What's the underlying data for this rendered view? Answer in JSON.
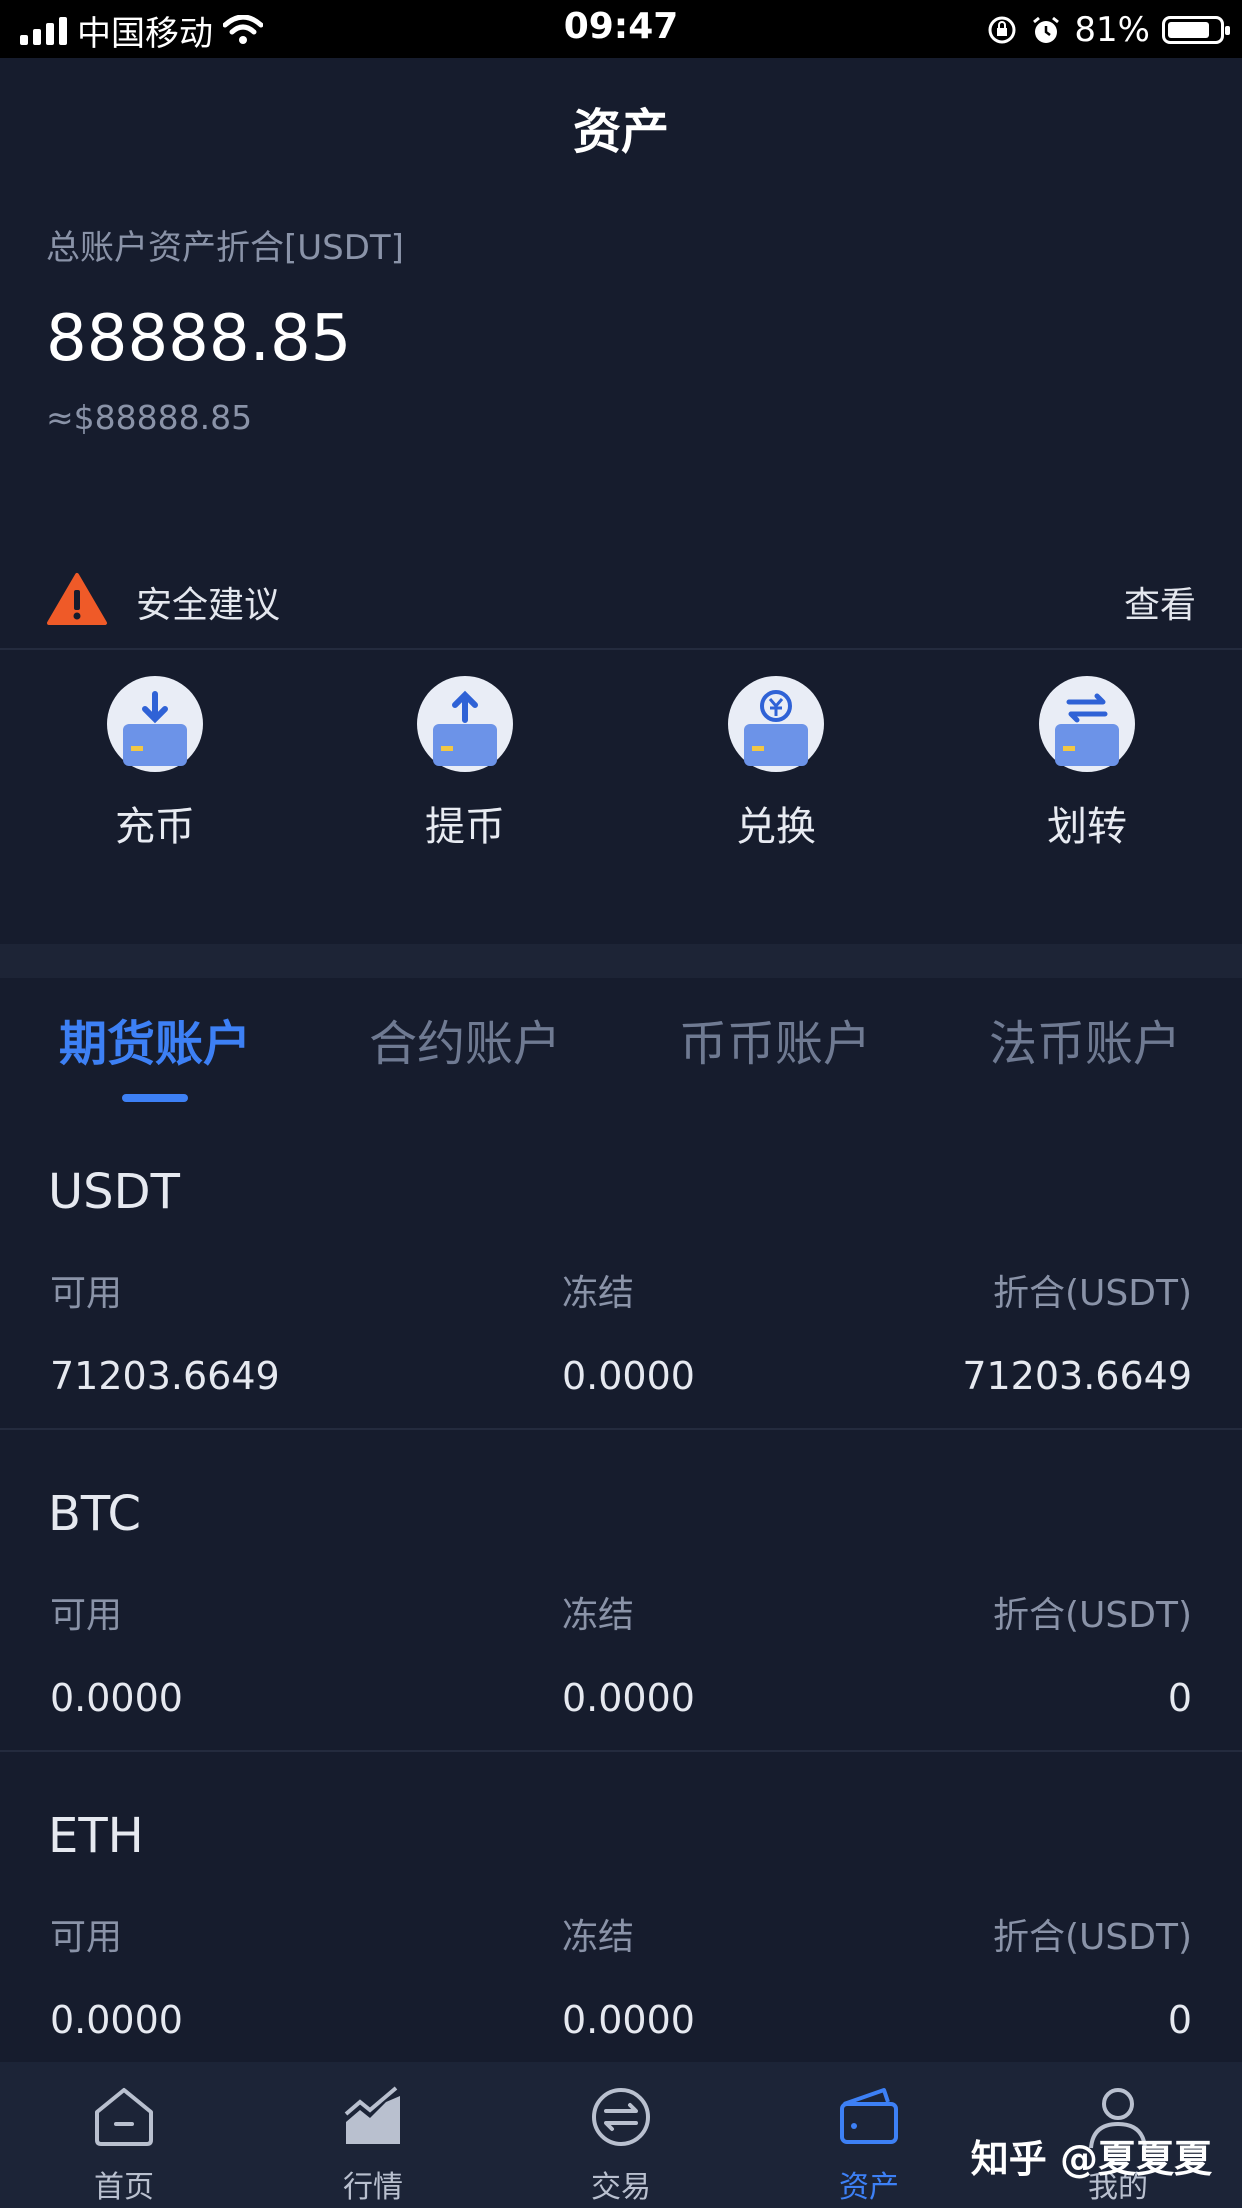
{
  "status_bar": {
    "carrier": "中国移动",
    "time": "09:47",
    "battery": "81%",
    "battery_level": 0.81
  },
  "header": {
    "title": "资产"
  },
  "summary": {
    "label": "总账户资产折合[USDT]",
    "value": "88888.85",
    "usd_value": "≈$88888.85"
  },
  "security": {
    "label": "安全建议",
    "action": "查看",
    "icon": "warning-triangle-icon",
    "color": "#ef5a28"
  },
  "actions": [
    {
      "label": "充币",
      "icon": "deposit-icon"
    },
    {
      "label": "提币",
      "icon": "withdraw-icon"
    },
    {
      "label": "兑换",
      "icon": "exchange-icon"
    },
    {
      "label": "划转",
      "icon": "transfer-icon"
    }
  ],
  "tabs": [
    {
      "label": "期货账户",
      "active": true
    },
    {
      "label": "合约账户",
      "active": false
    },
    {
      "label": "币币账户",
      "active": false
    },
    {
      "label": "法币账户",
      "active": false
    }
  ],
  "columns": {
    "available": "可用",
    "frozen": "冻结",
    "converted": "折合(USDT)"
  },
  "assets": [
    {
      "name": "USDT",
      "available": "71203.6649",
      "frozen": "0.0000",
      "converted": "71203.6649"
    },
    {
      "name": "BTC",
      "available": "0.0000",
      "frozen": "0.0000",
      "converted": "0"
    },
    {
      "name": "ETH",
      "available": "0.0000",
      "frozen": "0.0000",
      "converted": "0"
    }
  ],
  "tabbar": [
    {
      "label": "首页",
      "icon": "home-icon",
      "active": false
    },
    {
      "label": "行情",
      "icon": "market-chart-icon",
      "active": false
    },
    {
      "label": "交易",
      "icon": "trade-icon",
      "active": false
    },
    {
      "label": "资产",
      "icon": "wallet-icon",
      "active": true
    },
    {
      "label": "我的",
      "icon": "profile-icon",
      "active": false
    }
  ],
  "watermark": "知乎 @夏夏夏",
  "colors": {
    "accent": "#3d80f5",
    "background": "#161c2d",
    "muted": "#8a93a8"
  }
}
